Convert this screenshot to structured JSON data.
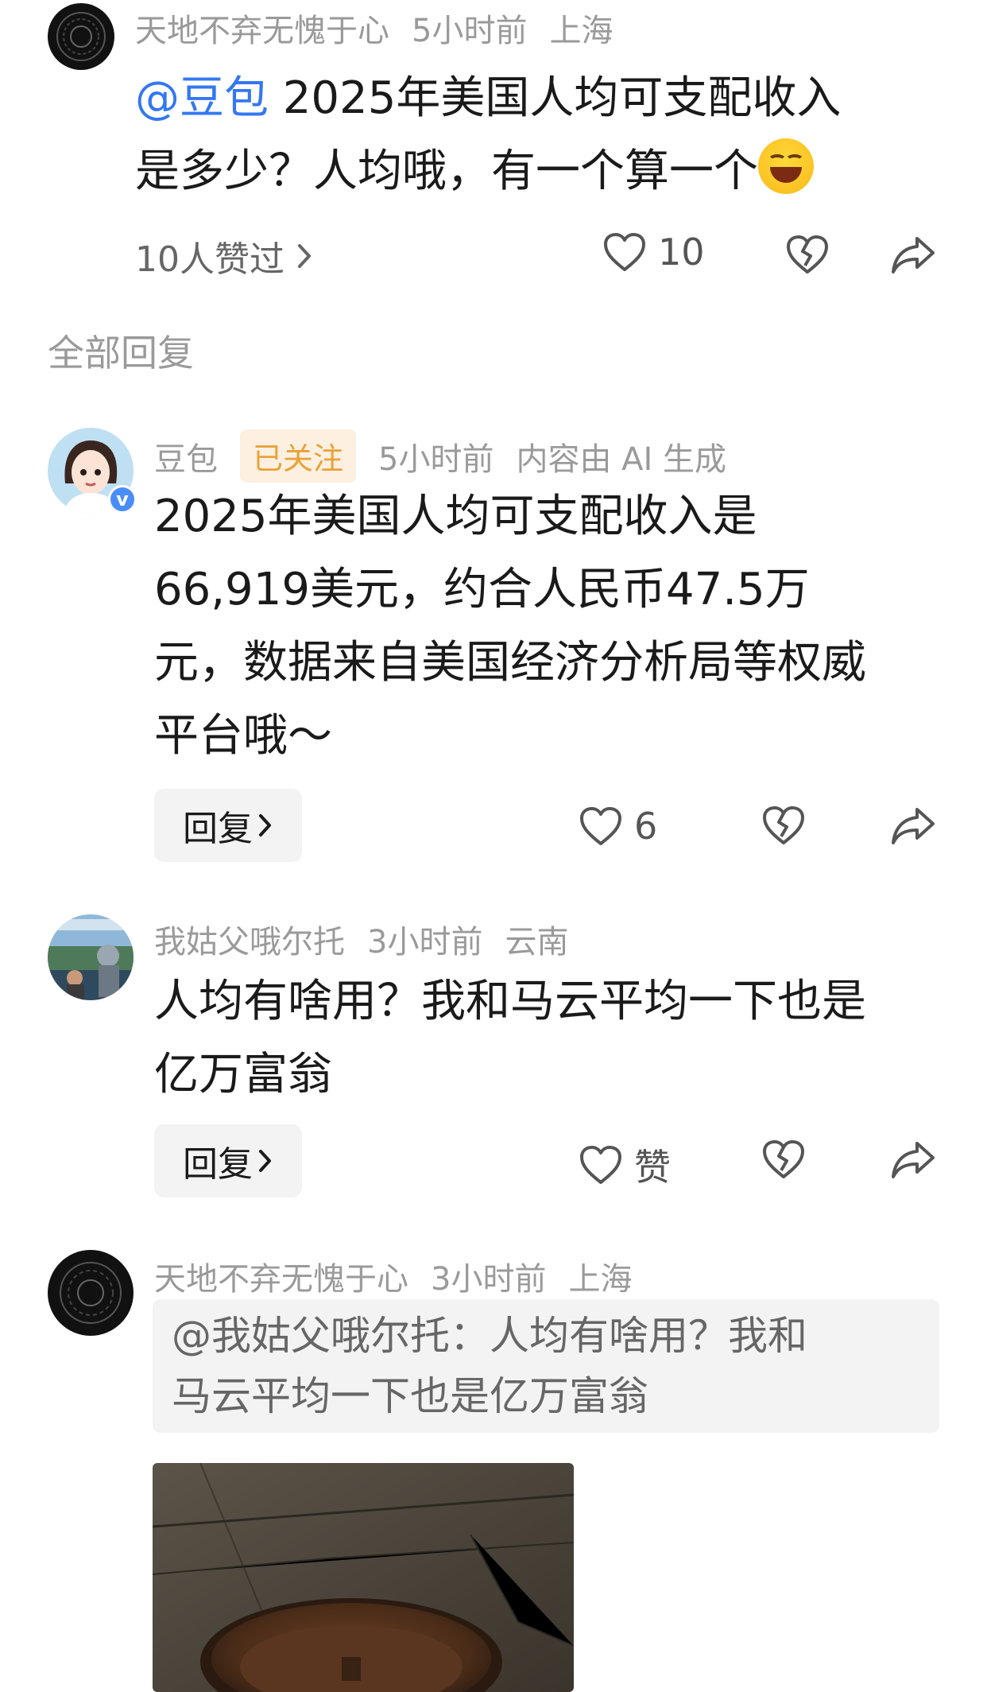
{
  "top_comment": {
    "author": "天地不弃无愧于心",
    "time": "5小时前",
    "location": "上海",
    "mention": "@豆包",
    "text_line1": " 2025年美国人均可支配收入",
    "text_line2": "是多少？人均哦，有一个算一个",
    "likes_summary": "10人赞过",
    "like_count": "10"
  },
  "section_title": "全部回复",
  "replies": [
    {
      "author": "豆包",
      "tag": "已关注",
      "time": "5小时前",
      "note": "内容由 AI 生成",
      "lines": [
        "2025年美国人均可支配收入是",
        "66,919美元，约合人民币47.5万",
        "元，数据来自美国经济分析局等权威",
        "平台哦～"
      ],
      "reply_label": "回复",
      "like_count": "6"
    },
    {
      "author": "我姑父哦尔托",
      "time": "3小时前",
      "location": "云南",
      "lines": [
        "人均有啥用？我和马云平均一下也是",
        "亿万富翁"
      ],
      "reply_label": "回复",
      "like_label": "赞"
    },
    {
      "author": "天地不弃无愧于心",
      "time": "3小时前",
      "location": "上海",
      "quote_line1": "@我姑父哦尔托：人均有啥用？我和",
      "quote_line2": "马云平均一下也是亿万富翁"
    }
  ],
  "colors": {
    "mention": "#3478f0",
    "meta": "#9a9a9a",
    "tag_bg": "#fdf0e0",
    "tag_text": "#e8a23b",
    "verified": "#4a8df8"
  }
}
